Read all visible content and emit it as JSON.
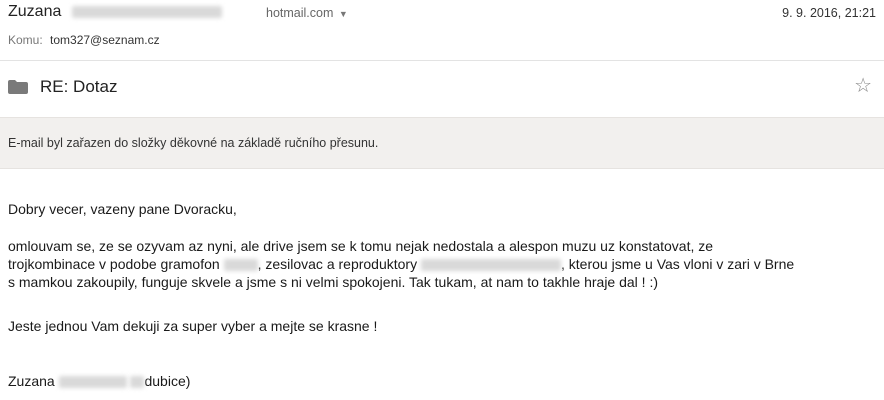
{
  "header": {
    "sender_name": "Zuzana",
    "sender_email_suffix": "hotmail.com",
    "date": "9. 9. 2016, 21:21",
    "recipient_label": "Komu:",
    "recipient": "tom327@seznam.cz"
  },
  "subject": "RE: Dotaz",
  "notice": "E-mail byl zařazen do složky děkovné na základě ručního přesunu.",
  "message": {
    "greeting": "Dobry vecer, vazeny pane Dvoracku,",
    "para_line1": "omlouvam se, ze se ozyvam az nyni, ale drive jsem se k tomu nejak nedostala a alespon muzu uz konstatovat, ze",
    "para_line2a": "trojkombinace v podobe gramofon",
    "para_line2b": ", zesilovac a reproduktory",
    "para_line2c": ", kterou jsme u Vas vloni v zari v Brne",
    "para_line3": "s mamkou zakoupily, funguje skvele a jsme s ni velmi spokojeni. Tak tukam, at nam to takhle hraje dal ! :)",
    "thanks": "Jeste jednou Vam dekuji za super vyber a mejte se krasne !",
    "signature_name": "Zuzana",
    "signature_city": "dubice)"
  },
  "icons": {
    "folder": "folder-icon",
    "star": "star-icon",
    "caret": "caret-down-icon"
  }
}
